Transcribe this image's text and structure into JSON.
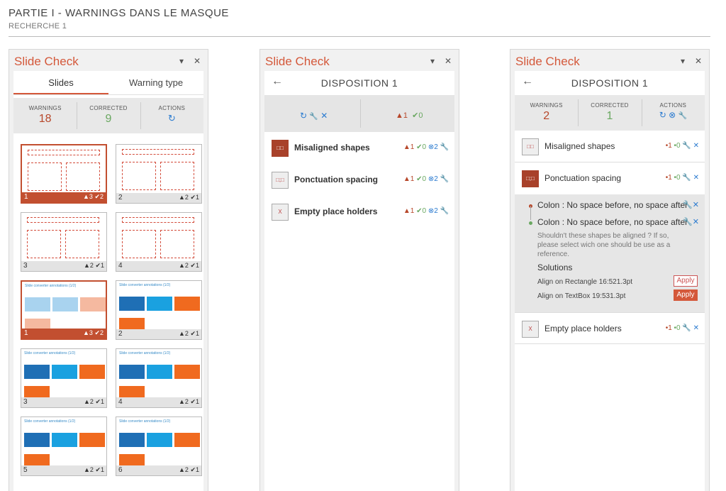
{
  "header": {
    "title": "PARTIE I - WARNINGS DANS LE MASQUE",
    "subtitle": "RECHERCHE 1"
  },
  "panel_title": "Slide Check",
  "icons": {
    "dropdown": "▾",
    "close": "✕",
    "back": "←",
    "refresh": "↻",
    "wrench": "🔧",
    "x": "✕",
    "warn": "▲",
    "check": "✔",
    "xcircle": "⊗"
  },
  "panel1": {
    "tabs": [
      "Slides",
      "Warning type"
    ],
    "stats": {
      "warnings_label": "WARNINGS",
      "warnings_value": "18",
      "corrected_label": "CORRECTED",
      "corrected_value": "9",
      "actions_label": "ACTIONS",
      "actions_icon": "C"
    },
    "thumbs": [
      {
        "num": "1",
        "warn": "3",
        "ok": "2",
        "selected": true,
        "kind": "layout"
      },
      {
        "num": "2",
        "warn": "2",
        "ok": "1",
        "selected": false,
        "kind": "layout"
      },
      {
        "num": "3",
        "warn": "2",
        "ok": "1",
        "selected": false,
        "kind": "layout"
      },
      {
        "num": "4",
        "warn": "2",
        "ok": "1",
        "selected": false,
        "kind": "layout"
      },
      {
        "num": "1",
        "warn": "3",
        "ok": "2",
        "selected": true,
        "kind": "slide",
        "mini": "Slide converter annotations (1/2)"
      },
      {
        "num": "2",
        "warn": "2",
        "ok": "1",
        "selected": false,
        "kind": "slide",
        "mini": "Slide converter annotations (1/2)"
      },
      {
        "num": "3",
        "warn": "2",
        "ok": "1",
        "selected": false,
        "kind": "slide",
        "mini": "Slide converter annotations (1/2)"
      },
      {
        "num": "4",
        "warn": "2",
        "ok": "1",
        "selected": false,
        "kind": "slide",
        "mini": "Slide converter annotations (1/2)"
      },
      {
        "num": "5",
        "warn": "2",
        "ok": "1",
        "selected": false,
        "kind": "slide",
        "mini": "Slide converter annotations (1/2)"
      },
      {
        "num": "6",
        "warn": "2",
        "ok": "1",
        "selected": false,
        "kind": "slide",
        "mini": "Slide converter annotations (1/2)"
      }
    ]
  },
  "panel2": {
    "nav_title": "DISPOSITION 1",
    "summary": {
      "warn": "1",
      "ok": "0"
    },
    "items": [
      {
        "label": "Misaligned shapes",
        "warn": "1",
        "ok": "0",
        "fix": "2",
        "icon": "misaligned-icon"
      },
      {
        "label": "Ponctuation spacing",
        "warn": "1",
        "ok": "0",
        "fix": "2",
        "icon": "punctuation-icon"
      },
      {
        "label": "Empty place holders",
        "warn": "1",
        "ok": "0",
        "fix": "2",
        "icon": "placeholder-icon"
      }
    ]
  },
  "panel3": {
    "nav_title": "DISPOSITION 1",
    "stats": {
      "warnings_label": "WARNINGS",
      "warnings_value": "2",
      "corrected_label": "CORRECTED",
      "corrected_value": "1",
      "actions_label": "ACTIONS"
    },
    "items": [
      {
        "label": "Misaligned shapes",
        "counts": "•1 •0"
      },
      {
        "label": "Ponctuation spacing",
        "counts": "•1 •0"
      },
      {
        "label": "Empty place holders",
        "counts": "•1 •0"
      }
    ],
    "warnings": [
      "Colon : No space before, no space after",
      "Colon : No space before, no space after"
    ],
    "description": "Shouldn't these shapes be aligned ? If so, please select wich one should be use as a reference.",
    "solutions_title": "Solutions",
    "solutions": [
      {
        "label": "Align on Rectangle 16:521.3pt",
        "button": "Apply"
      },
      {
        "label": "Align on TextBox 19:531.3pt",
        "button": "Apply"
      }
    ]
  }
}
